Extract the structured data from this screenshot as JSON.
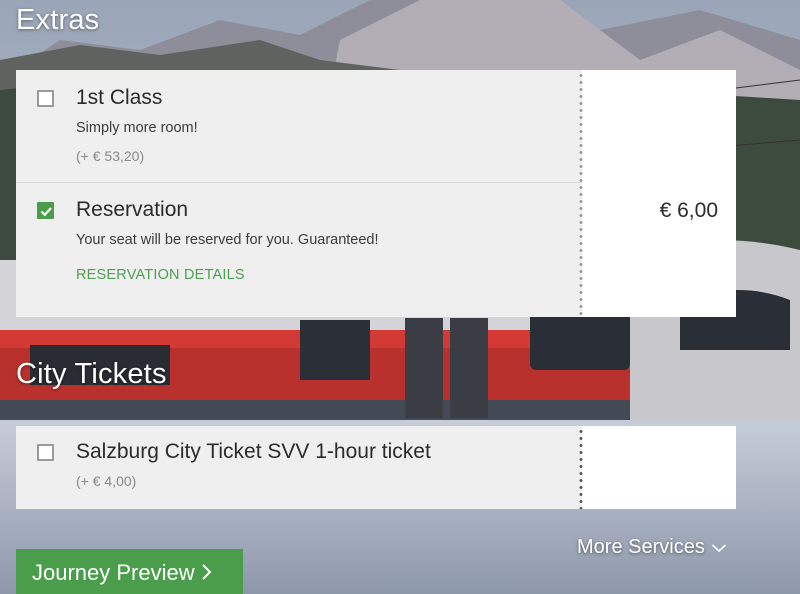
{
  "sections": {
    "extras_title": "Extras",
    "city_title": "City Tickets"
  },
  "extras": {
    "first_class": {
      "title": "1st Class",
      "description": "Simply more room!",
      "surcharge": "(+ € 53,20)",
      "checked": false
    },
    "reservation": {
      "title": "Reservation",
      "description": "Your seat will be reserved for you. Guaranteed!",
      "link": "RESERVATION DETAILS",
      "price": "€ 6,00",
      "checked": true
    }
  },
  "city_tickets": {
    "salzburg": {
      "title": "Salzburg City Ticket SVV 1-hour ticket",
      "surcharge": "(+ € 4,00)",
      "checked": false
    }
  },
  "footer": {
    "more_services": "More Services",
    "journey_preview": "Journey Preview"
  },
  "colors": {
    "accent_green": "#4a9d4a",
    "link_green": "#4f9f53",
    "card_bg": "#efefef",
    "price_bg": "#ffffff"
  },
  "icons": {
    "checkbox_checked": "checkmark-icon",
    "more_services": "chevron-down-icon",
    "journey_preview": "chevron-right-icon"
  }
}
